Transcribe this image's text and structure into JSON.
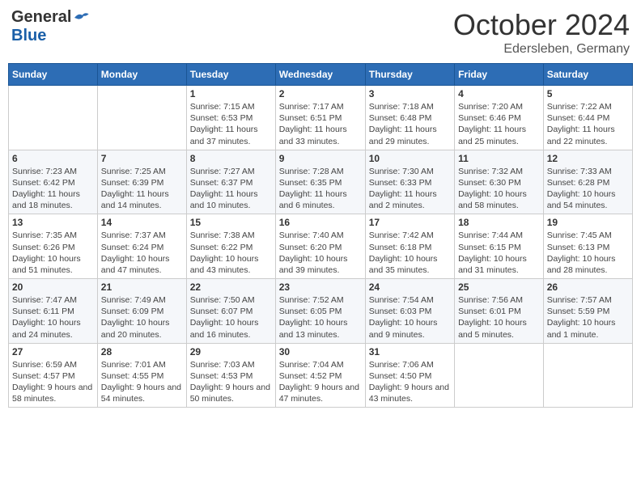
{
  "header": {
    "logo_general": "General",
    "logo_blue": "Blue",
    "month": "October 2024",
    "location": "Edersleben, Germany"
  },
  "days_of_week": [
    "Sunday",
    "Monday",
    "Tuesday",
    "Wednesday",
    "Thursday",
    "Friday",
    "Saturday"
  ],
  "weeks": [
    [
      {
        "day": "",
        "info": ""
      },
      {
        "day": "",
        "info": ""
      },
      {
        "day": "1",
        "info": "Sunrise: 7:15 AM\nSunset: 6:53 PM\nDaylight: 11 hours and 37 minutes."
      },
      {
        "day": "2",
        "info": "Sunrise: 7:17 AM\nSunset: 6:51 PM\nDaylight: 11 hours and 33 minutes."
      },
      {
        "day": "3",
        "info": "Sunrise: 7:18 AM\nSunset: 6:48 PM\nDaylight: 11 hours and 29 minutes."
      },
      {
        "day": "4",
        "info": "Sunrise: 7:20 AM\nSunset: 6:46 PM\nDaylight: 11 hours and 25 minutes."
      },
      {
        "day": "5",
        "info": "Sunrise: 7:22 AM\nSunset: 6:44 PM\nDaylight: 11 hours and 22 minutes."
      }
    ],
    [
      {
        "day": "6",
        "info": "Sunrise: 7:23 AM\nSunset: 6:42 PM\nDaylight: 11 hours and 18 minutes."
      },
      {
        "day": "7",
        "info": "Sunrise: 7:25 AM\nSunset: 6:39 PM\nDaylight: 11 hours and 14 minutes."
      },
      {
        "day": "8",
        "info": "Sunrise: 7:27 AM\nSunset: 6:37 PM\nDaylight: 11 hours and 10 minutes."
      },
      {
        "day": "9",
        "info": "Sunrise: 7:28 AM\nSunset: 6:35 PM\nDaylight: 11 hours and 6 minutes."
      },
      {
        "day": "10",
        "info": "Sunrise: 7:30 AM\nSunset: 6:33 PM\nDaylight: 11 hours and 2 minutes."
      },
      {
        "day": "11",
        "info": "Sunrise: 7:32 AM\nSunset: 6:30 PM\nDaylight: 10 hours and 58 minutes."
      },
      {
        "day": "12",
        "info": "Sunrise: 7:33 AM\nSunset: 6:28 PM\nDaylight: 10 hours and 54 minutes."
      }
    ],
    [
      {
        "day": "13",
        "info": "Sunrise: 7:35 AM\nSunset: 6:26 PM\nDaylight: 10 hours and 51 minutes."
      },
      {
        "day": "14",
        "info": "Sunrise: 7:37 AM\nSunset: 6:24 PM\nDaylight: 10 hours and 47 minutes."
      },
      {
        "day": "15",
        "info": "Sunrise: 7:38 AM\nSunset: 6:22 PM\nDaylight: 10 hours and 43 minutes."
      },
      {
        "day": "16",
        "info": "Sunrise: 7:40 AM\nSunset: 6:20 PM\nDaylight: 10 hours and 39 minutes."
      },
      {
        "day": "17",
        "info": "Sunrise: 7:42 AM\nSunset: 6:18 PM\nDaylight: 10 hours and 35 minutes."
      },
      {
        "day": "18",
        "info": "Sunrise: 7:44 AM\nSunset: 6:15 PM\nDaylight: 10 hours and 31 minutes."
      },
      {
        "day": "19",
        "info": "Sunrise: 7:45 AM\nSunset: 6:13 PM\nDaylight: 10 hours and 28 minutes."
      }
    ],
    [
      {
        "day": "20",
        "info": "Sunrise: 7:47 AM\nSunset: 6:11 PM\nDaylight: 10 hours and 24 minutes."
      },
      {
        "day": "21",
        "info": "Sunrise: 7:49 AM\nSunset: 6:09 PM\nDaylight: 10 hours and 20 minutes."
      },
      {
        "day": "22",
        "info": "Sunrise: 7:50 AM\nSunset: 6:07 PM\nDaylight: 10 hours and 16 minutes."
      },
      {
        "day": "23",
        "info": "Sunrise: 7:52 AM\nSunset: 6:05 PM\nDaylight: 10 hours and 13 minutes."
      },
      {
        "day": "24",
        "info": "Sunrise: 7:54 AM\nSunset: 6:03 PM\nDaylight: 10 hours and 9 minutes."
      },
      {
        "day": "25",
        "info": "Sunrise: 7:56 AM\nSunset: 6:01 PM\nDaylight: 10 hours and 5 minutes."
      },
      {
        "day": "26",
        "info": "Sunrise: 7:57 AM\nSunset: 5:59 PM\nDaylight: 10 hours and 1 minute."
      }
    ],
    [
      {
        "day": "27",
        "info": "Sunrise: 6:59 AM\nSunset: 4:57 PM\nDaylight: 9 hours and 58 minutes."
      },
      {
        "day": "28",
        "info": "Sunrise: 7:01 AM\nSunset: 4:55 PM\nDaylight: 9 hours and 54 minutes."
      },
      {
        "day": "29",
        "info": "Sunrise: 7:03 AM\nSunset: 4:53 PM\nDaylight: 9 hours and 50 minutes."
      },
      {
        "day": "30",
        "info": "Sunrise: 7:04 AM\nSunset: 4:52 PM\nDaylight: 9 hours and 47 minutes."
      },
      {
        "day": "31",
        "info": "Sunrise: 7:06 AM\nSunset: 4:50 PM\nDaylight: 9 hours and 43 minutes."
      },
      {
        "day": "",
        "info": ""
      },
      {
        "day": "",
        "info": ""
      }
    ]
  ]
}
